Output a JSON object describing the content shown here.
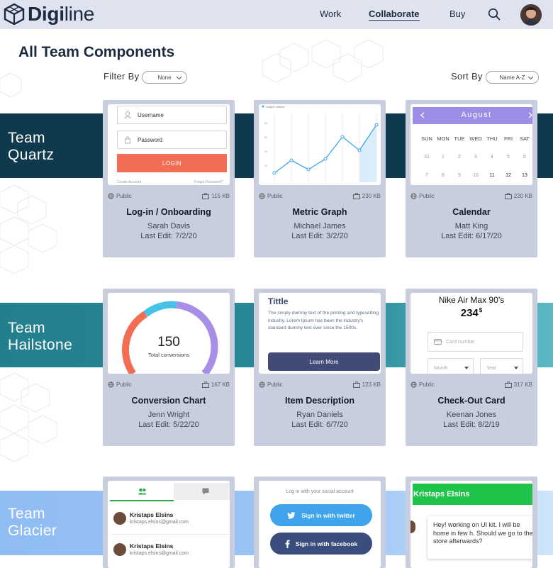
{
  "header": {
    "logo_bold": "Digi",
    "logo_light": "line",
    "nav": [
      {
        "label": "Work",
        "active": false
      },
      {
        "label": "Collaborate",
        "active": true
      },
      {
        "label": "Buy",
        "active": false
      }
    ],
    "search_icon": "search-icon",
    "avatar_icon": "user-avatar"
  },
  "page": {
    "title": "All Team Components",
    "filter_label": "Filter By",
    "filter_value": "None",
    "sort_label": "Sort By",
    "sort_value": "Name A-Z"
  },
  "teams": [
    {
      "name_line1": "Team",
      "name_line2": "Quartz",
      "color": "#0f3a4e",
      "cards": [
        {
          "title": "Log-in / Onboarding",
          "author": "Sarah Davis",
          "last_edit": "Last Edit: 7/2/20",
          "visibility": "Public",
          "size": "115 KB",
          "preview": {
            "username": "Username",
            "password": "Password",
            "login": "LOGIN",
            "create_account": "Create Account",
            "forgot": "Forgot Password?"
          }
        },
        {
          "title": "Metric Graph",
          "author": "Michael James",
          "last_edit": "Last Edit: 3/2/20",
          "visibility": "Public",
          "size": "230 KB",
          "preview": {
            "legend": "Unique visitors"
          }
        },
        {
          "title": "Calendar",
          "author": "Matt King",
          "last_edit": "Last Edit: 6/17/20",
          "visibility": "Public",
          "size": "220 KB",
          "preview": {
            "month": "August",
            "dow": [
              "SUN",
              "MON",
              "TUE",
              "WED",
              "THU",
              "FRI",
              "SAT"
            ],
            "week1": [
              "31",
              "1",
              "2",
              "3",
              "4",
              "5",
              "6"
            ],
            "week2": [
              "7",
              "8",
              "9",
              "10",
              "11",
              "12",
              "13"
            ]
          }
        }
      ]
    },
    {
      "name_line1": "Team",
      "name_line2": "Hailstone",
      "color": "#237e8e",
      "cards": [
        {
          "title": "Conversion Chart",
          "author": "Jenn Wright",
          "last_edit": "Last Edit: 5/22/20",
          "visibility": "Public",
          "size": "167 KB",
          "preview": {
            "value": "150",
            "label": "Total conversions"
          }
        },
        {
          "title": "Item Description",
          "author": "Ryan Daniels",
          "last_edit": "Last Edit: 6/7/20",
          "visibility": "Public",
          "size": "123 KB",
          "preview": {
            "heading": "Tittle",
            "body": "The simply dummy text of the printing and typesetting industry. Lorem Ipsum has been the industry's standard dummy text ever since the 1500s.",
            "button": "Learn More"
          }
        },
        {
          "title": "Check-Out Card",
          "author": "Keenan Jones",
          "last_edit": "Last Edit: 8/2/19",
          "visibility": "Public",
          "size": "317 KB",
          "preview": {
            "product": "Nike Air Max 90’s",
            "price": "234",
            "currency": "$",
            "card_placeholder": "Card number",
            "month": "Month",
            "year": "Year"
          }
        }
      ]
    },
    {
      "name_line1": "Team",
      "name_line2": "Glacier",
      "color": "#8fbcf3",
      "cards": [
        {
          "preview": {
            "contacts": [
              {
                "name": "Kristaps Elsins",
                "email": "kristaps.elsins@gmail.com"
              },
              {
                "name": "Kristaps Elsins",
                "email": "kristaps.elsins@gmail.com"
              }
            ]
          }
        },
        {
          "preview": {
            "hint": "Log in with your social account",
            "twitter": "Sign in with twitter",
            "facebook": "Sign in with facebook"
          }
        },
        {
          "preview": {
            "name": "Kristaps Elsins",
            "message": "Hey! working on UI kit. I will be home in few h. Should we go to the store afterwards?"
          }
        }
      ]
    }
  ],
  "colors": {
    "header_bg": "#dfe3ef",
    "card_bg": "#c9cede",
    "login_button": "#f36d55",
    "calendar_header": "#9d8de6",
    "learn_more": "#424b78",
    "twitter": "#3fa4ec",
    "facebook": "#3b4d7c",
    "chat_green": "#1dc449"
  }
}
